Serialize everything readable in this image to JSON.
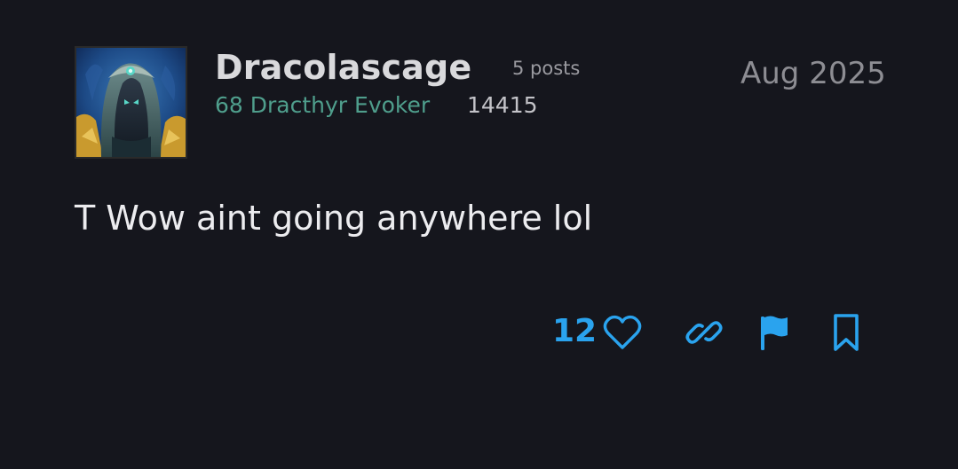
{
  "post": {
    "author": {
      "name": "Dracolascage",
      "posts": "5 posts",
      "character": "68 Dracthyr Evoker",
      "rating": "14415"
    },
    "date": "Aug 2025",
    "content": "T Wow aint going anywhere lol",
    "likes": "12"
  },
  "icons": {
    "like": "heart-icon",
    "share": "link-icon",
    "flag": "flag-icon",
    "bookmark": "bookmark-icon"
  },
  "colors": {
    "background": "#15161d",
    "accent": "#2aa3ee",
    "character_text": "#4f9e8c"
  }
}
